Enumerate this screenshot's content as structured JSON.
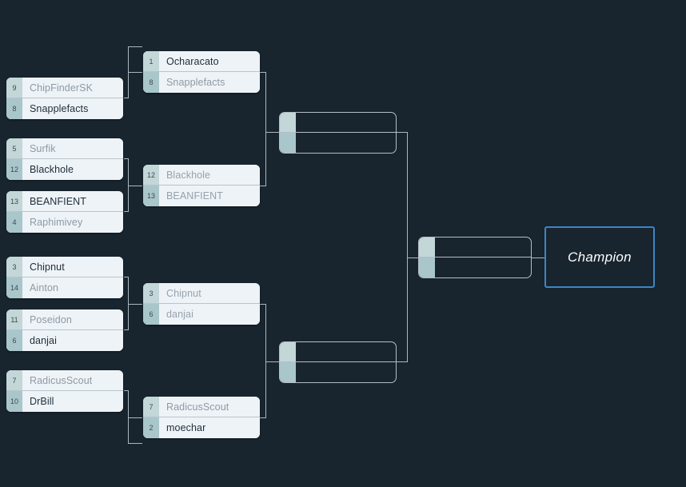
{
  "theme": {
    "background": "#18242e",
    "box_fill": "#eef3f7",
    "seed_fill": "#b8cfd2",
    "winner_text": "#1f2d3a",
    "loser_text": "#8e9aa4",
    "connector": "#aeb6bd",
    "champion_border": "#3d85c6",
    "champion_text": "#ffffff"
  },
  "champion": {
    "label": "Champion",
    "value": ""
  },
  "rounds": [
    {
      "name": "round-1",
      "matches": [
        {
          "id": "r1m1",
          "top": {
            "seed": "9",
            "name": "ChipFinderSK",
            "state": "loser"
          },
          "bottom": {
            "seed": "8",
            "name": "Snapplefacts",
            "state": "winner"
          }
        },
        {
          "id": "r1m2",
          "top": {
            "seed": "5",
            "name": "Surfik",
            "state": "loser"
          },
          "bottom": {
            "seed": "12",
            "name": "Blackhole",
            "state": "winner"
          }
        },
        {
          "id": "r1m3",
          "top": {
            "seed": "13",
            "name": "BEANFIENT",
            "state": "winner"
          },
          "bottom": {
            "seed": "4",
            "name": "Raphimivey",
            "state": "loser"
          }
        },
        {
          "id": "r1m4",
          "top": {
            "seed": "3",
            "name": "Chipnut",
            "state": "winner"
          },
          "bottom": {
            "seed": "14",
            "name": "Ainton",
            "state": "loser"
          }
        },
        {
          "id": "r1m5",
          "top": {
            "seed": "11",
            "name": "Poseidon",
            "state": "loser"
          },
          "bottom": {
            "seed": "6",
            "name": "danjai",
            "state": "winner"
          }
        },
        {
          "id": "r1m6",
          "top": {
            "seed": "7",
            "name": "RadicusScout",
            "state": "loser"
          },
          "bottom": {
            "seed": "10",
            "name": "DrBill",
            "state": "winner"
          }
        }
      ]
    },
    {
      "name": "round-2",
      "matches": [
        {
          "id": "r2m1",
          "top": {
            "seed": "1",
            "name": "Ocharacato",
            "state": "winner"
          },
          "bottom": {
            "seed": "8",
            "name": "Snapplefacts",
            "state": "loser"
          }
        },
        {
          "id": "r2m2",
          "top": {
            "seed": "12",
            "name": "Blackhole",
            "state": "pending"
          },
          "bottom": {
            "seed": "13",
            "name": "BEANFIENT",
            "state": "pending"
          }
        },
        {
          "id": "r2m3",
          "top": {
            "seed": "3",
            "name": "Chipnut",
            "state": "pending"
          },
          "bottom": {
            "seed": "6",
            "name": "danjai",
            "state": "pending"
          }
        },
        {
          "id": "r2m4",
          "top": {
            "seed": "7",
            "name": "RadicusScout",
            "state": "loser"
          },
          "bottom": {
            "seed": "2",
            "name": "moechar",
            "state": "winner"
          }
        }
      ]
    },
    {
      "name": "semifinals",
      "matches": [
        {
          "id": "sf1",
          "top": {
            "seed": "",
            "name": "",
            "state": "empty"
          },
          "bottom": {
            "seed": "",
            "name": "",
            "state": "empty"
          }
        },
        {
          "id": "sf2",
          "top": {
            "seed": "",
            "name": "",
            "state": "empty"
          },
          "bottom": {
            "seed": "",
            "name": "",
            "state": "empty"
          }
        }
      ]
    },
    {
      "name": "final",
      "matches": [
        {
          "id": "f1",
          "top": {
            "seed": "",
            "name": "",
            "state": "empty"
          },
          "bottom": {
            "seed": "",
            "name": "",
            "state": "empty"
          }
        }
      ]
    }
  ]
}
